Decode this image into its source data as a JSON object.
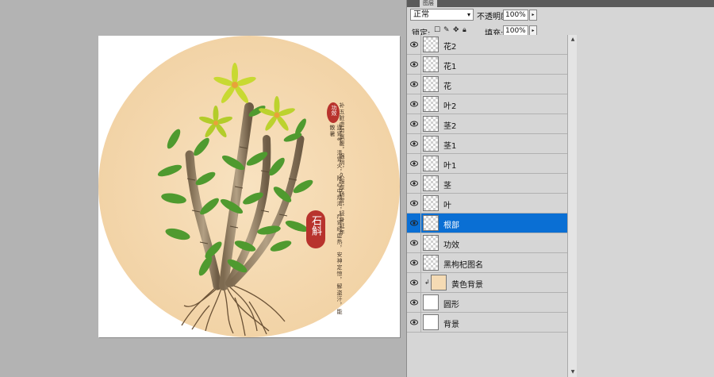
{
  "colors": {
    "workspace": "#b3b3b3",
    "panel": "#d6d6d6",
    "selection": "#0a6fd4",
    "circle_background": "#f5dbb4",
    "stamp_red": "#b8332d"
  },
  "layers_panel": {
    "tab_label": "图层",
    "blend_mode": "正常",
    "opacity_label": "不透明度:",
    "opacity_value": "100%",
    "lock_label": "锁定:",
    "fill_label": "填充:",
    "fill_value": "100%",
    "layers": [
      {
        "name": "花2",
        "thumbnail": "transparent",
        "visible": true,
        "selected": false,
        "clipped": false
      },
      {
        "name": "花1",
        "thumbnail": "transparent",
        "visible": true,
        "selected": false,
        "clipped": false
      },
      {
        "name": "花",
        "thumbnail": "transparent",
        "visible": true,
        "selected": false,
        "clipped": false
      },
      {
        "name": "叶2",
        "thumbnail": "transparent",
        "visible": true,
        "selected": false,
        "clipped": false
      },
      {
        "name": "茎2",
        "thumbnail": "transparent",
        "visible": true,
        "selected": false,
        "clipped": false
      },
      {
        "name": "茎1",
        "thumbnail": "transparent",
        "visible": true,
        "selected": false,
        "clipped": false
      },
      {
        "name": "叶1",
        "thumbnail": "transparent",
        "visible": true,
        "selected": false,
        "clipped": false
      },
      {
        "name": "茎",
        "thumbnail": "transparent",
        "visible": true,
        "selected": false,
        "clipped": false
      },
      {
        "name": "叶",
        "thumbnail": "transparent",
        "visible": true,
        "selected": false,
        "clipped": false
      },
      {
        "name": "根部",
        "thumbnail": "transparent",
        "visible": true,
        "selected": true,
        "clipped": false
      },
      {
        "name": "功效",
        "thumbnail": "transparent",
        "visible": true,
        "selected": false,
        "clipped": false
      },
      {
        "name": "黑枸杞图名",
        "thumbnail": "transparent",
        "visible": true,
        "selected": false,
        "clipped": false
      },
      {
        "name": "黄色背景",
        "thumbnail": "#f5dbb4",
        "visible": true,
        "selected": false,
        "clipped": true
      },
      {
        "name": "圆形",
        "thumbnail": "#ffffff",
        "visible": true,
        "selected": false,
        "clipped": false
      },
      {
        "name": "背景",
        "thumbnail": "#ffffff",
        "visible": true,
        "selected": false,
        "clipped": false
      }
    ]
  },
  "artwork": {
    "title_stamp": "石斛",
    "small_stamp": "功效",
    "description_columns": [
      "补五脏虚劳羸瘦，强阴，久服厚肠胃，轻身延年",
      "逐肾气，清胃火，除心中烦渴，疗肾经虚热，安神定惊，解盗汗，能散暑"
    ]
  }
}
